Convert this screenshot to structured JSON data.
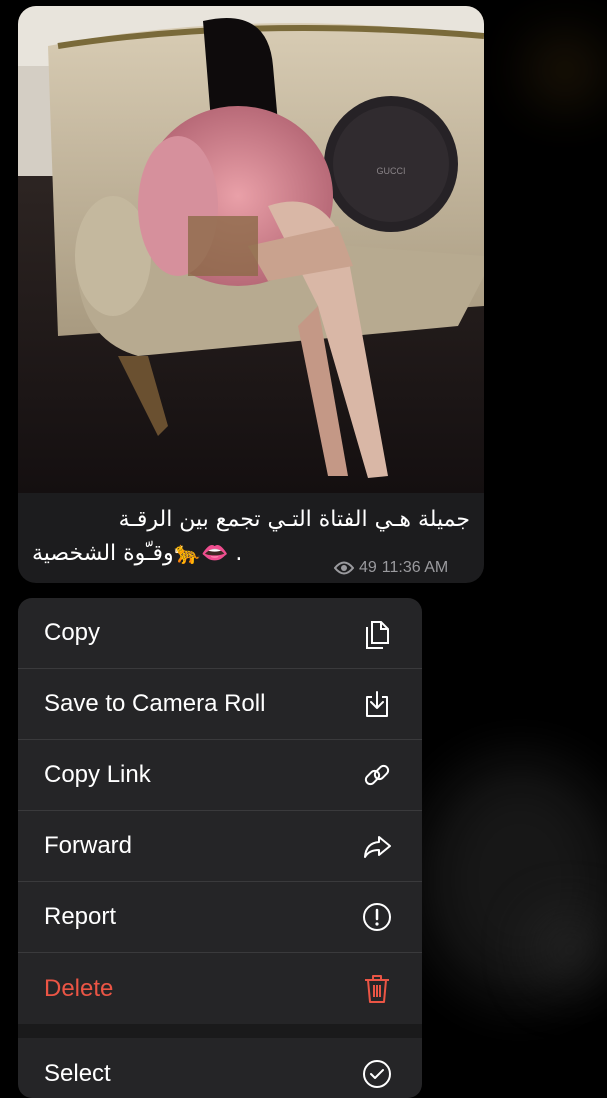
{
  "message": {
    "caption_rtl": "جميلة هـي الفتاة التـي تجمع بين الرقـة",
    "caption_line2": "وقـّوة الشخصية🐆👄 .",
    "views": "49",
    "time": "11:36 AM",
    "views_icon": "eye-icon",
    "photo_box_text": "GUCCI"
  },
  "menu": {
    "items": [
      {
        "label": "Copy",
        "icon": "copy-icon"
      },
      {
        "label": "Save to Camera Roll",
        "icon": "download-icon"
      },
      {
        "label": "Copy Link",
        "icon": "link-icon"
      },
      {
        "label": "Forward",
        "icon": "forward-icon"
      },
      {
        "label": "Report",
        "icon": "report-icon"
      },
      {
        "label": "Delete",
        "icon": "trash-icon"
      },
      {
        "label": "Select",
        "icon": "checkmark-circle-icon"
      }
    ],
    "danger_color": "#eb5545"
  }
}
